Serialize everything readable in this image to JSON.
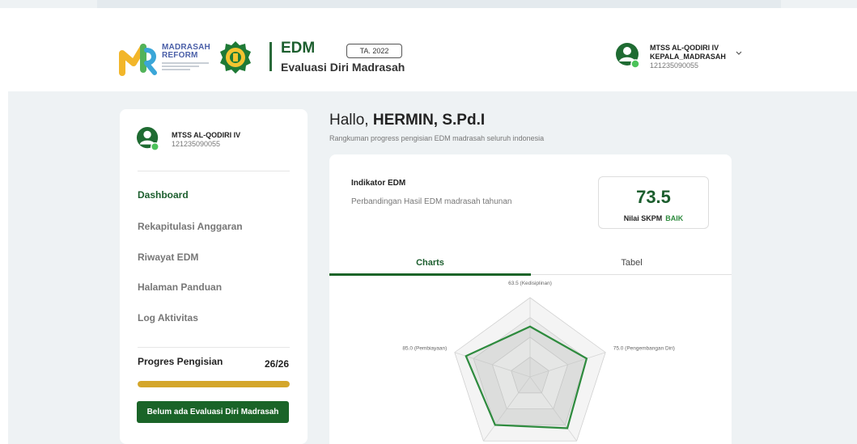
{
  "header": {
    "brand_line1": "MADRASAH",
    "brand_line2": "REFORM",
    "app_title": "EDM",
    "app_subtitle": "Evaluasi Diri Madrasah",
    "year_badge": "TA. 2022",
    "user": {
      "school": "MTSS AL-QODIRI IV",
      "role": "KEPALA_MADRASAH",
      "npsn": "121235090055"
    }
  },
  "sidebar": {
    "school": "MTSS AL-QODIRI IV",
    "npsn": "121235090055",
    "nav": [
      {
        "label": "Dashboard",
        "active": true
      },
      {
        "label": "Rekapitulasi Anggaran",
        "active": false
      },
      {
        "label": "Riwayat EDM",
        "active": false
      },
      {
        "label": "Halaman Panduan",
        "active": false
      },
      {
        "label": "Log Aktivitas",
        "active": false
      }
    ],
    "progress": {
      "label": "Progres Pengisian",
      "count": "26/26",
      "fraction": 1.0
    },
    "empty_button": "Belum ada Evaluasi Diri Madrasah"
  },
  "main": {
    "greeting_prefix": "Hallo,",
    "greeting_name": "HERMIN, S.Pd.I",
    "subtitle": "Rangkuman progress pengisian EDM madrasah seluruh indonesia",
    "card": {
      "title": "Indikator EDM",
      "subtitle": "Perbandingan Hasil EDM madrasah tahunan",
      "score": "73.5",
      "score_label": "Nilai SKPM",
      "score_rating": "BAIK",
      "tabs": [
        {
          "label": "Charts",
          "active": true
        },
        {
          "label": "Tabel",
          "active": false
        }
      ]
    }
  },
  "colors": {
    "primary_green": "#1c5e2e",
    "button_green": "#1a6428",
    "progress_gold": "#d4a62a",
    "rating_green": "#2e8b3e"
  },
  "chart_data": {
    "type": "radar",
    "max": 100,
    "axes": [
      {
        "label": "63.5 (Kedisiplinan)",
        "value": 63.5
      },
      {
        "label": "75.0 (Pengembangan Diri)",
        "value": 75.0
      },
      {
        "label": "",
        "value": 80
      },
      {
        "label": "",
        "value": 75
      },
      {
        "label": "85.0 (Pembiayaan)",
        "value": 85.0
      }
    ]
  }
}
